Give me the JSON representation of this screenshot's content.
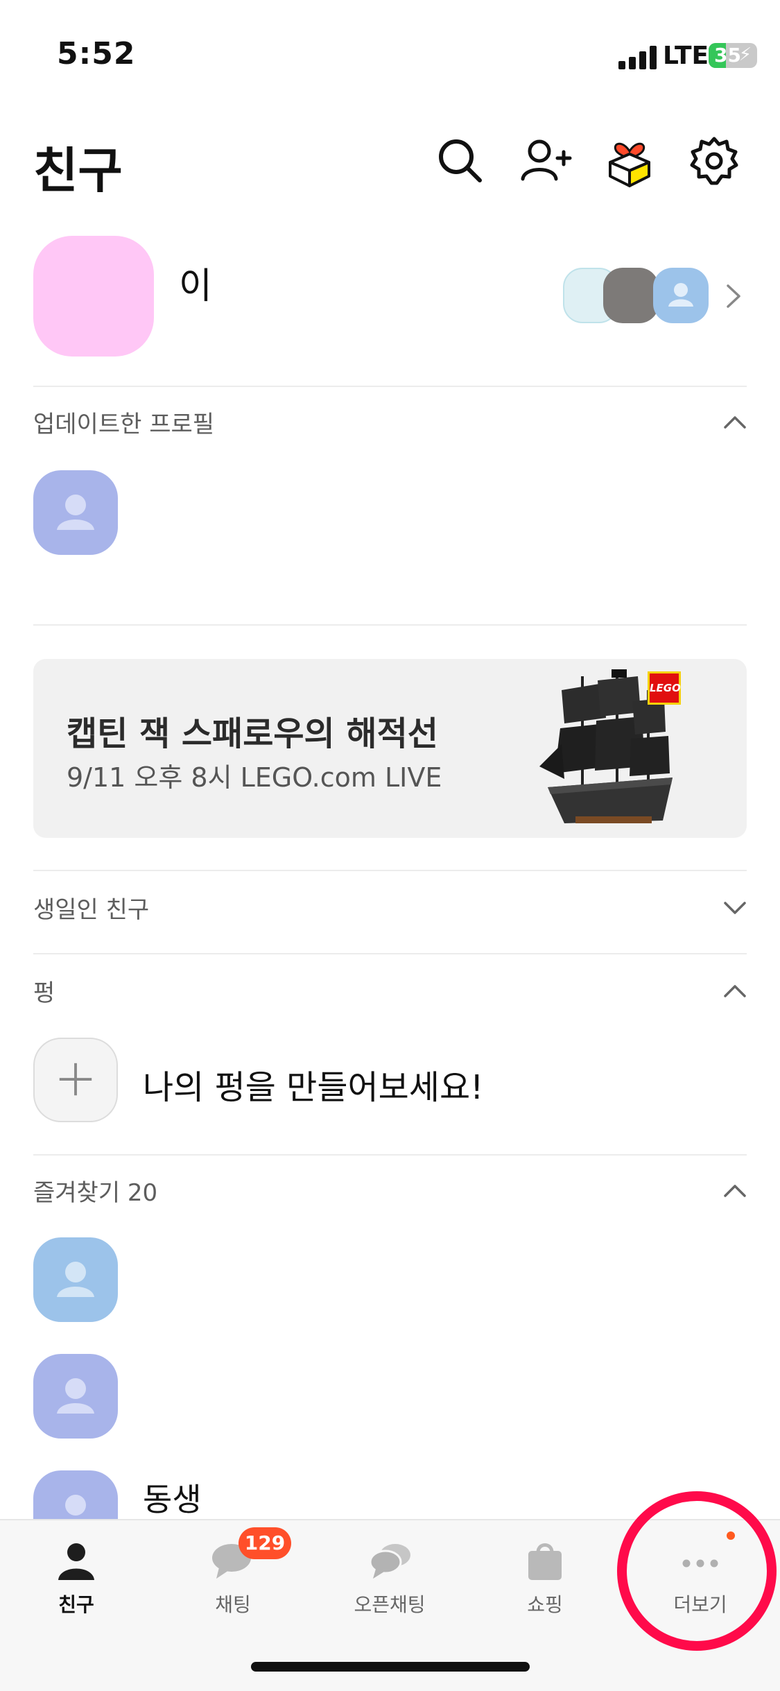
{
  "status_bar": {
    "time": "5:52",
    "network": "LTE",
    "battery": "35"
  },
  "header": {
    "title": "친구",
    "icons": [
      "search-icon",
      "add-friend-icon",
      "gift-icon",
      "settings-icon"
    ]
  },
  "profile": {
    "name": "이"
  },
  "sections": {
    "updated_profiles": "업데이트한 프로필",
    "birthdays": "생일인 친구",
    "pung": "펑",
    "favorites": "즐겨찾기 20"
  },
  "banner": {
    "title": "캡틴 잭 스패로우의 해적선",
    "subtitle": "9/11 오후 8시 LEGO.com LIVE",
    "logo_text": "LEGO"
  },
  "pung": {
    "create_prompt": "나의 펑을 만들어보세요!"
  },
  "favorites": {
    "visible_name": "동생"
  },
  "tabbar": {
    "tabs": [
      {
        "label": "친구",
        "icon": "person-icon",
        "active": true
      },
      {
        "label": "채팅",
        "icon": "chat-icon",
        "badge": "129"
      },
      {
        "label": "오픈채팅",
        "icon": "open-chat-icon"
      },
      {
        "label": "쇼핑",
        "icon": "shopping-bag-icon"
      },
      {
        "label": "더보기",
        "icon": "more-icon",
        "dot": true
      }
    ]
  },
  "colors": {
    "my_avatar": "#ffc7f6",
    "avatar_purple": "#a8b4ea",
    "avatar_blue": "#9cc3ea",
    "badge": "#ff4f2a",
    "highlight_ring": "#ff0a4a"
  }
}
